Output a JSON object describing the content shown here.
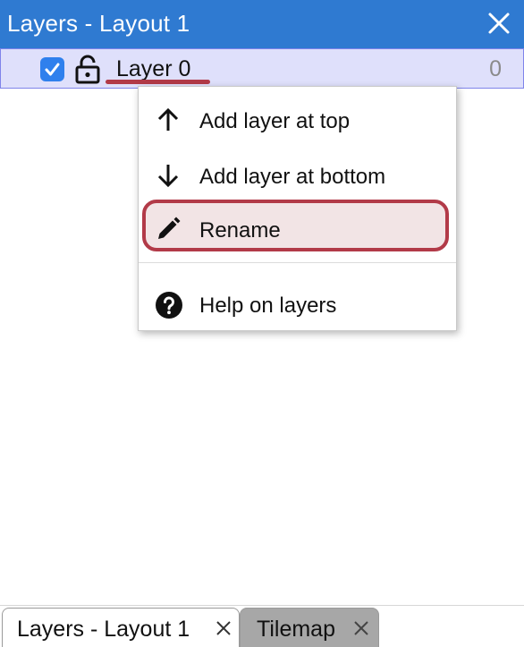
{
  "panel": {
    "title": "Layers - Layout 1",
    "close_icon": "close-icon",
    "accent_color": "#2f7ad1"
  },
  "layers": [
    {
      "name": "Layer 0",
      "count": "0",
      "visible": true,
      "locked": false
    }
  ],
  "context_menu": {
    "items": [
      {
        "label": "Add layer at top",
        "icon": "arrow-up-icon"
      },
      {
        "label": "Add layer at bottom",
        "icon": "arrow-down-icon"
      },
      {
        "label": "Rename",
        "icon": "pencil-icon",
        "highlighted": true
      },
      {
        "label": "Help on layers",
        "icon": "help-circle-icon"
      }
    ],
    "highlight_color": "#b23a48"
  },
  "tabs": [
    {
      "label": "Layers - Layout 1",
      "active": true
    },
    {
      "label": "Tilemap",
      "active": false
    }
  ]
}
